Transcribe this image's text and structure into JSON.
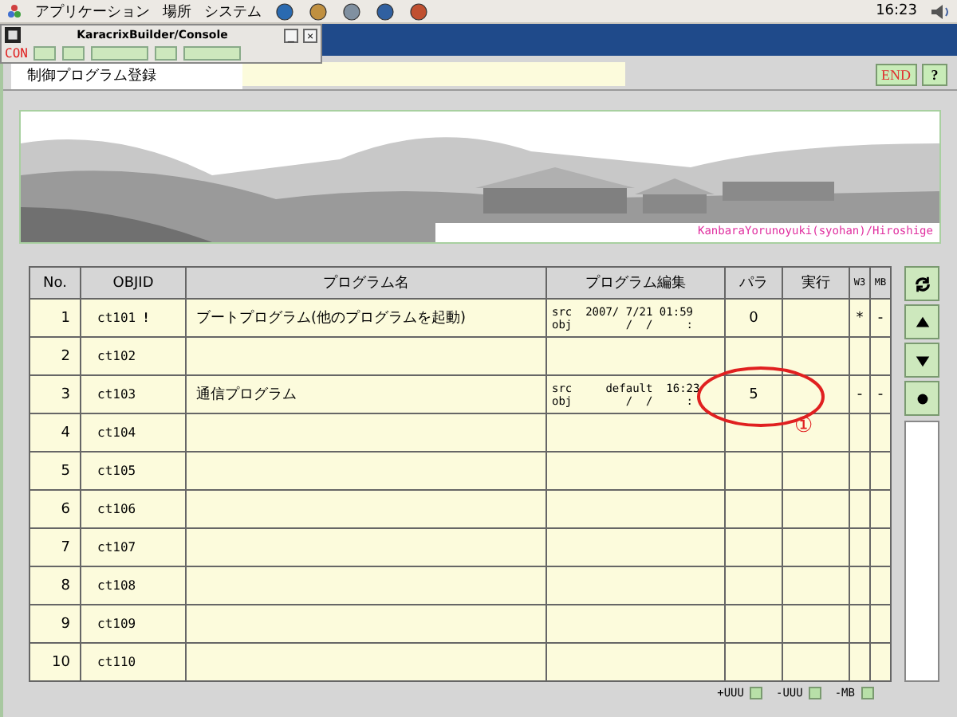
{
  "top_panel": {
    "menus": [
      "アプリケーション",
      "場所",
      "システム"
    ],
    "clock": "16:23"
  },
  "console_window": {
    "title": "KaracrixBuilder/Console",
    "controls": [
      "_",
      "×"
    ],
    "tag": "CON"
  },
  "header": {
    "title": "制御プログラム登録",
    "buttons": [
      "END",
      "?"
    ]
  },
  "banner": {
    "kind": "picture",
    "caption": "KanbaraYorunoyuki(syohan)/Hiroshige"
  },
  "table": {
    "columns": [
      "No.",
      "OBJID",
      "プログラム名",
      "プログラム編集",
      "パラ",
      "実行",
      "W3",
      "MB"
    ],
    "rows": [
      {
        "no": "1",
        "objid": "ct101",
        "flag": "!",
        "name": "ブートプログラム(他のプログラムを起動)",
        "edit": [
          "src  2007/ 7/21 01:59",
          "obj        /  /     :"
        ],
        "para": "0",
        "w3": "*",
        "mb": "-"
      },
      {
        "no": "2",
        "objid": "ct102"
      },
      {
        "no": "3",
        "objid": "ct103",
        "name": "通信プログラム",
        "edit": [
          "src     default  16:23",
          "obj        /  /     :"
        ],
        "para": "5",
        "w3": "-",
        "mb": "-"
      },
      {
        "no": "4",
        "objid": "ct104"
      },
      {
        "no": "5",
        "objid": "ct105"
      },
      {
        "no": "6",
        "objid": "ct106"
      },
      {
        "no": "7",
        "objid": "ct107"
      },
      {
        "no": "8",
        "objid": "ct108"
      },
      {
        "no": "9",
        "objid": "ct109"
      },
      {
        "no": "10",
        "objid": "ct110"
      }
    ]
  },
  "annotation": {
    "mark": "①"
  },
  "footer": [
    "+UUU",
    "-UUU",
    "-MB"
  ]
}
